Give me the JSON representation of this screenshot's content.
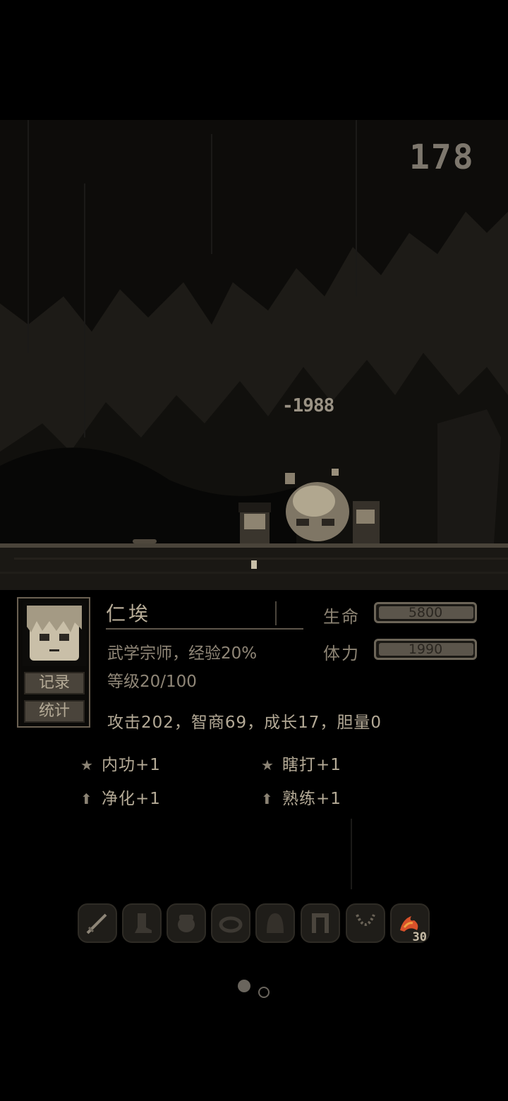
{
  "hud": {
    "counter": "178",
    "damage_popup": "-1988"
  },
  "character": {
    "name": "仁埃",
    "title_line": "武学宗师，经验20%",
    "level_line": "等级20/100",
    "stats_line": "攻击202，智商69，成长17，胆量0",
    "buttons": {
      "record": "记录",
      "stats": "统计"
    },
    "hp": {
      "label": "生命",
      "value": "5800",
      "fill": 1.0
    },
    "stamina": {
      "label": "体力",
      "value": "1990",
      "fill": 1.0
    }
  },
  "bonuses": [
    {
      "icon": "star-icon",
      "text": "内功+1"
    },
    {
      "icon": "star-icon",
      "text": "瞎打+1"
    },
    {
      "icon": "arrow-up-icon",
      "text": "净化+1"
    },
    {
      "icon": "arrow-up-icon",
      "text": "熟练+1"
    }
  ],
  "equipment": [
    {
      "icon": "sword-icon"
    },
    {
      "icon": "boot-icon"
    },
    {
      "icon": "glove-icon"
    },
    {
      "icon": "ring-icon"
    },
    {
      "icon": "hood-icon"
    },
    {
      "icon": "cloak-icon"
    },
    {
      "icon": "necklace-icon"
    },
    {
      "icon": "flame-item-icon",
      "count": "30"
    }
  ],
  "pager": {
    "pages": 2,
    "current": 1
  },
  "colors": {
    "background": "#000000",
    "text": "#b4aa96",
    "dim": "#8f8677",
    "bar_border": "#6c6558"
  }
}
